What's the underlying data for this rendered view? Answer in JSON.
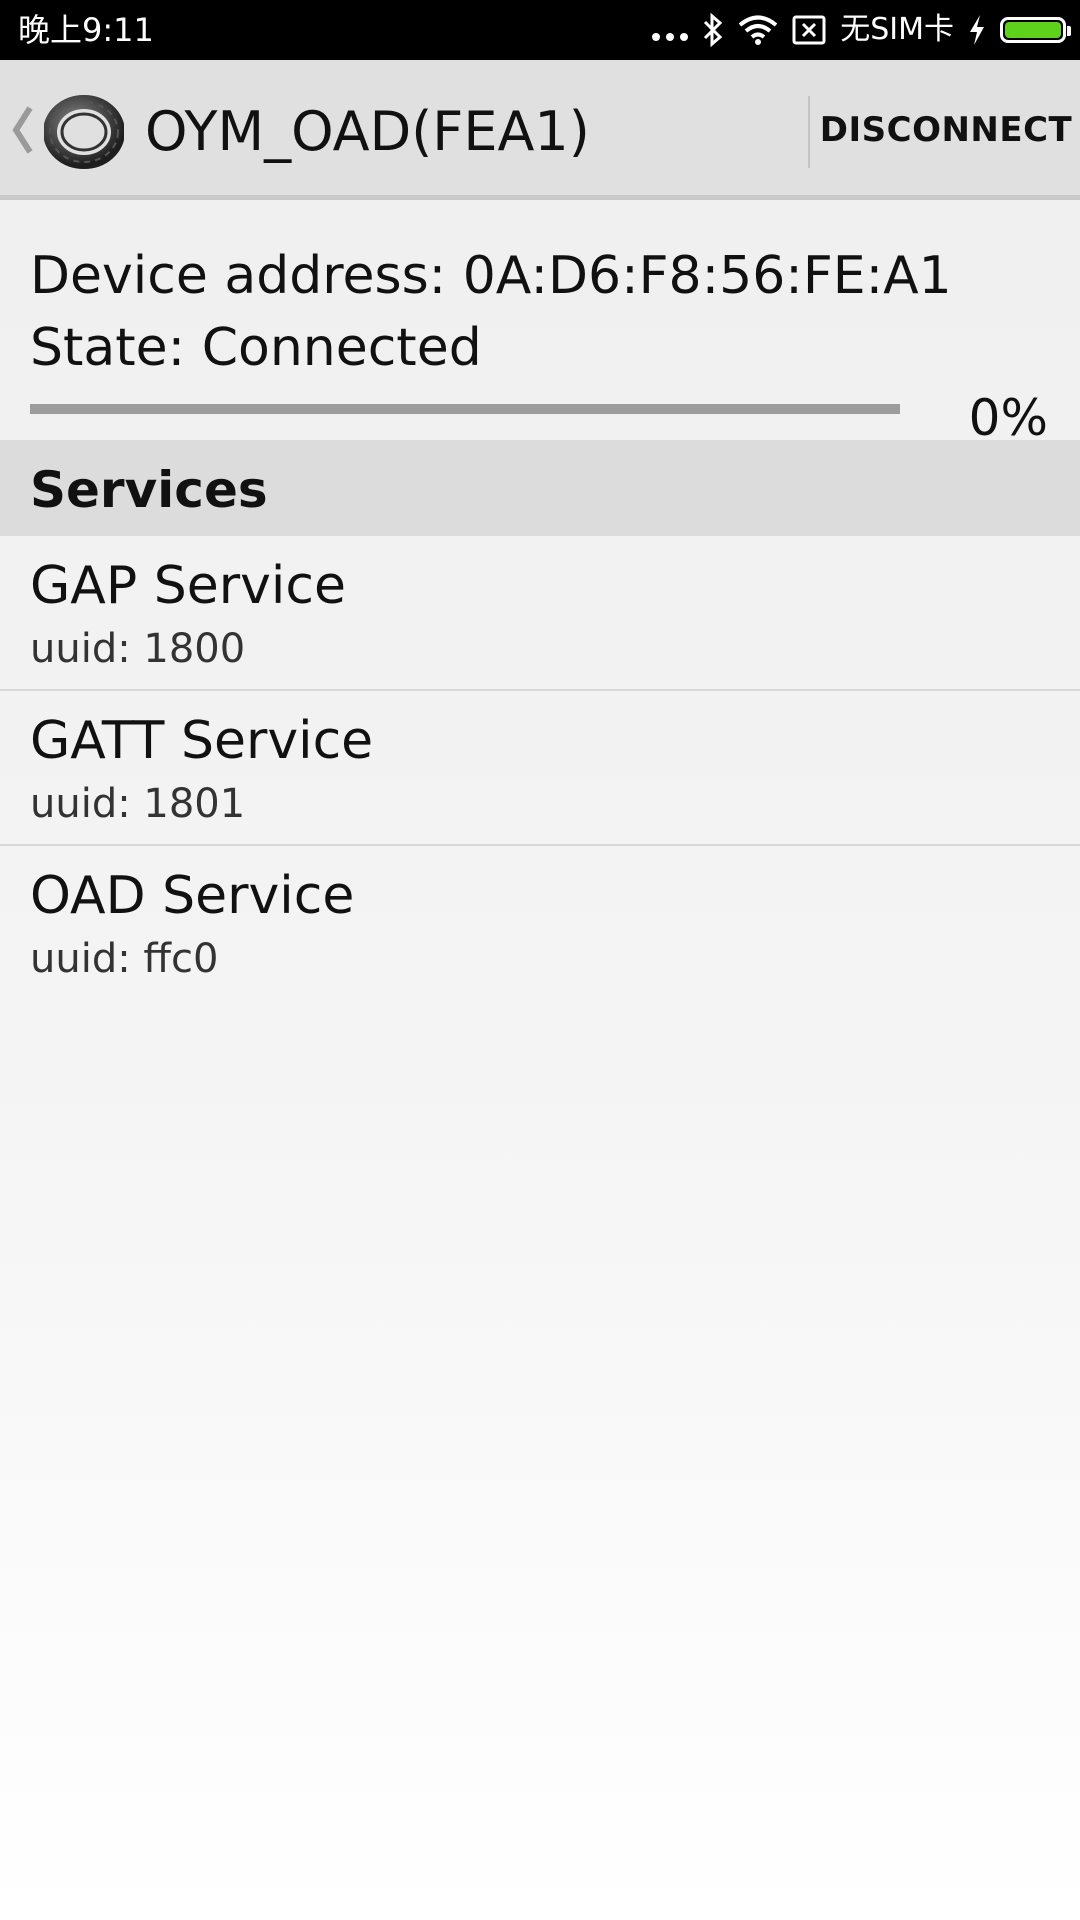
{
  "status_bar": {
    "time": "晚上9:11",
    "carrier": "无SIM卡",
    "icons": [
      "more-dots-icon",
      "bluetooth-icon",
      "wifi-icon",
      "no-sim-icon",
      "charging-icon",
      "battery-icon"
    ],
    "battery_color": "#5ed11b"
  },
  "action_bar": {
    "title": "OYM_OAD(FEA1)",
    "disconnect_label": "DISCONNECT",
    "back_icon": "chevron-left-icon",
    "app_icon": "band-device-icon"
  },
  "device": {
    "address_line": "Device address: 0A:D6:F8:56:FE:A1",
    "state_line": "State: Connected",
    "progress_text": "0%",
    "progress_value": 0
  },
  "services": {
    "header": "Services",
    "items": [
      {
        "name": "GAP Service",
        "uuid": "uuid: 1800"
      },
      {
        "name": "GATT Service",
        "uuid": "uuid: 1801"
      },
      {
        "name": "OAD Service",
        "uuid": "uuid: ffc0"
      }
    ]
  }
}
